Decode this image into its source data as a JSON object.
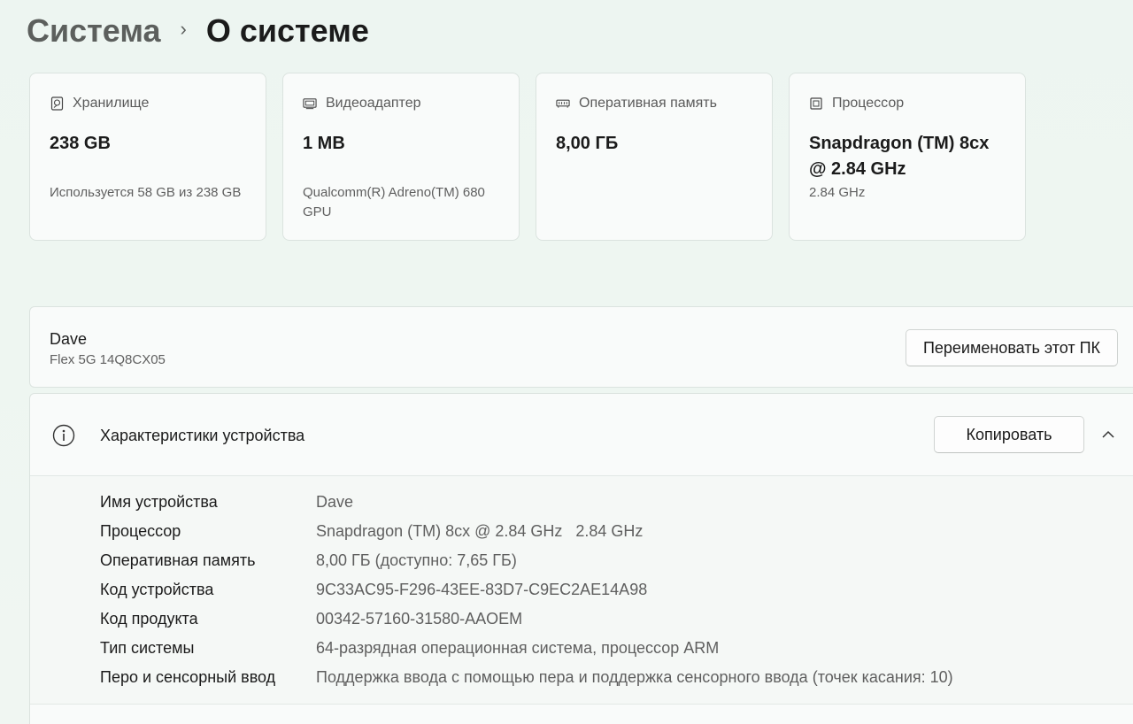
{
  "breadcrumb": {
    "parent": "Система",
    "separator": "›",
    "current": "О системе"
  },
  "cards": [
    {
      "icon": "hard-drive-icon",
      "label": "Хранилище",
      "value": "238 GB",
      "sub": "Используется 58 GB из 238 GB"
    },
    {
      "icon": "display-adapter-icon",
      "label": "Видеоадаптер",
      "value": "1 MB",
      "sub": "Qualcomm(R) Adreno(TM) 680 GPU"
    },
    {
      "icon": "memory-icon",
      "label": "Оперативная память",
      "value": "8,00 ГБ",
      "sub": ""
    },
    {
      "icon": "processor-icon",
      "label": "Процессор",
      "value": "Snapdragon (TM) 8cx @ 2.84 GHz",
      "sub": "2.84 GHz"
    }
  ],
  "device": {
    "name": "Dave",
    "model": "Flex 5G 14Q8CX05",
    "rename_label": "Переименовать этот ПК"
  },
  "specs": {
    "title": "Характеристики устройства",
    "copy_label": "Копировать",
    "rows": [
      {
        "key": "Имя устройства",
        "value": "Dave"
      },
      {
        "key": "Процессор",
        "value": "Snapdragon (TM) 8cx @ 2.84 GHz   2.84 GHz"
      },
      {
        "key": "Оперативная память",
        "value": "8,00 ГБ (доступно: 7,65 ГБ)"
      },
      {
        "key": "Код устройства",
        "value": "9C33AC95-F296-43EE-83D7-C9EC2AE14A98"
      },
      {
        "key": "Код продукта",
        "value": "00342-57160-31580-AAOEM"
      },
      {
        "key": "Тип системы",
        "value": "64-разрядная операционная система, процессор ARM"
      },
      {
        "key": "Перо и сенсорный ввод",
        "value": "Поддержка ввода с помощью пера и поддержка сенсорного ввода (точек касания: 10)"
      }
    ]
  }
}
